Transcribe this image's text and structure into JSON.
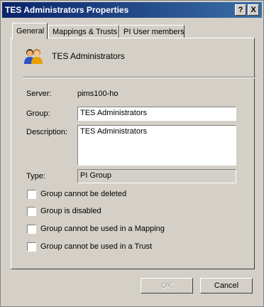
{
  "window": {
    "title": "TES Administrators Properties",
    "help_btn": "?",
    "close_btn": "X"
  },
  "tabs": [
    {
      "label": "General",
      "active": true
    },
    {
      "label": "Mappings & Trusts",
      "active": false
    },
    {
      "label": "PI User members",
      "active": false
    }
  ],
  "header": {
    "name": "TES Administrators",
    "icon": "user-group-icon"
  },
  "form": {
    "server_label": "Server:",
    "server_value": "pims100-ho",
    "group_label": "Group:",
    "group_value": "TES Administrators",
    "description_label": "Description:",
    "description_value": "TES Administrators",
    "type_label": "Type:",
    "type_value": "PI Group"
  },
  "checkboxes": [
    {
      "label": "Group cannot be deleted",
      "checked": false
    },
    {
      "label": "Group is disabled",
      "checked": false
    },
    {
      "label": "Group cannot be used in a Mapping",
      "checked": false
    },
    {
      "label": "Group cannot be used in a Trust",
      "checked": false
    }
  ],
  "buttons": {
    "ok": "OK",
    "cancel": "Cancel"
  }
}
